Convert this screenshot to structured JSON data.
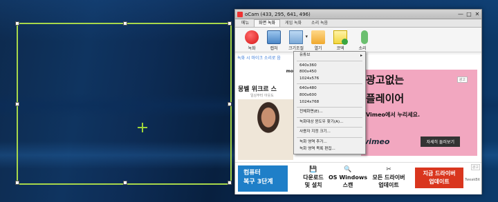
{
  "window": {
    "title": "oCam (433, 295, 641, 496)",
    "controls": [
      "—",
      "□",
      "✕"
    ]
  },
  "tabs": [
    "메뉴",
    "화면 녹화",
    "게임 녹화",
    "소리 녹음"
  ],
  "toolbar": [
    {
      "label": "녹화",
      "icon": "record-icon"
    },
    {
      "label": "캡처",
      "icon": "capture-icon"
    },
    {
      "label": "크기조절",
      "icon": "resize-icon"
    },
    {
      "label": "열기",
      "icon": "folder-icon"
    },
    {
      "label": "코덱",
      "icon": "codec-icon"
    },
    {
      "label": "소리",
      "icon": "microphone-icon"
    }
  ],
  "content": {
    "notice": "녹화 시 마이크 소리로 음"
  },
  "ad_left": {
    "brand": "mo",
    "headline": "몽벨 위크르 스",
    "sub": "일상부터 아웃도"
  },
  "ad_right": {
    "tag": "광고",
    "line1": "광고없는",
    "line2": "플레이어",
    "line3": "Vimeo에서 누리세요.",
    "logo": "vimeo",
    "button": "자세히 둘러보기"
  },
  "banner": {
    "left_line1": "컴퓨터",
    "left_line2": "복구 3단계",
    "items": [
      {
        "icon": "💾",
        "line1": "다운로드",
        "line2": "및 설치"
      },
      {
        "icon": "🔍",
        "line1": "OS Windows",
        "line2": "스캔"
      },
      {
        "icon": "✂",
        "line1": "모든 드라이버",
        "line2": "업데이트"
      }
    ],
    "cta_line1": "지금 드라이버",
    "cta_line2": "업데이트",
    "brand": "TweakBit",
    "ad": "광고"
  },
  "menu": {
    "items": [
      {
        "label": "유튜브",
        "sub": true
      },
      {
        "sep": true
      },
      {
        "label": "640x360"
      },
      {
        "label": "800x450"
      },
      {
        "label": "1024x576"
      },
      {
        "sep": true
      },
      {
        "label": "640x480"
      },
      {
        "label": "800x600"
      },
      {
        "label": "1024x768"
      },
      {
        "sep": true
      },
      {
        "label": "전체화면(E)..."
      },
      {
        "sep": true
      },
      {
        "label": "녹화대상 윈도우 찾기(A)..."
      },
      {
        "sep": true
      },
      {
        "label": "사용자 지정 크기..."
      },
      {
        "sep": true
      },
      {
        "label": "녹화 영역 추가..."
      },
      {
        "label": "녹화 영역 목록 편집..."
      }
    ]
  },
  "colors": {
    "selection_border": "#a8d84a",
    "banner_blue": "#1f7fc8",
    "cta_red": "#d9361e",
    "vimeo_pink": "#f2a7c0"
  }
}
